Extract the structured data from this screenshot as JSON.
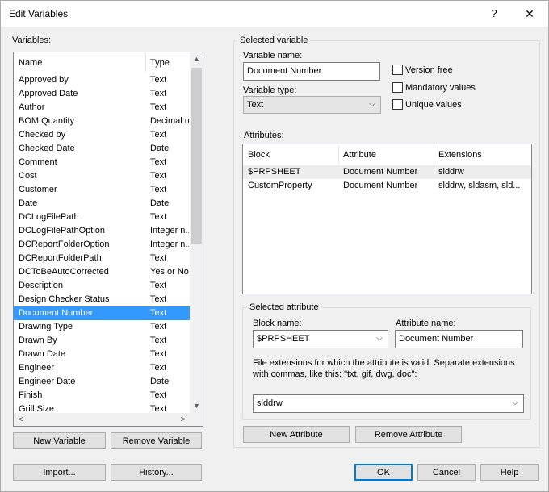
{
  "window": {
    "title": "Edit Variables",
    "help": "?",
    "close": "✕"
  },
  "variables": {
    "label": "Variables:",
    "col_name": "Name",
    "col_type": "Type",
    "items": [
      {
        "name": "Approved by",
        "type": "Text"
      },
      {
        "name": "Approved Date",
        "type": "Text"
      },
      {
        "name": "Author",
        "type": "Text"
      },
      {
        "name": "BOM Quantity",
        "type": "Decimal n..."
      },
      {
        "name": "Checked by",
        "type": "Text"
      },
      {
        "name": "Checked Date",
        "type": "Date"
      },
      {
        "name": "Comment",
        "type": "Text"
      },
      {
        "name": "Cost",
        "type": "Text"
      },
      {
        "name": "Customer",
        "type": "Text"
      },
      {
        "name": "Date",
        "type": "Date"
      },
      {
        "name": "DCLogFilePath",
        "type": "Text"
      },
      {
        "name": "DCLogFilePathOption",
        "type": "Integer n..."
      },
      {
        "name": "DCReportFolderOption",
        "type": "Integer n..."
      },
      {
        "name": "DCReportFolderPath",
        "type": "Text"
      },
      {
        "name": "DCToBeAutoCorrected",
        "type": "Yes or No"
      },
      {
        "name": "Description",
        "type": "Text"
      },
      {
        "name": "Design Checker Status",
        "type": "Text"
      },
      {
        "name": "Document Number",
        "type": "Text"
      },
      {
        "name": "Drawing Type",
        "type": "Text"
      },
      {
        "name": "Drawn By",
        "type": "Text"
      },
      {
        "name": "Drawn Date",
        "type": "Text"
      },
      {
        "name": "Engineer",
        "type": "Text"
      },
      {
        "name": "Engineer Date",
        "type": "Date"
      },
      {
        "name": "Finish",
        "type": "Text"
      },
      {
        "name": "Grill Size",
        "type": "Text"
      }
    ],
    "selected_index": 17,
    "new_button": "New Variable",
    "remove_button": "Remove Variable",
    "import_button": "Import...",
    "history_button": "History..."
  },
  "selected_variable": {
    "group_title": "Selected variable",
    "name_label": "Variable name:",
    "name_value": "Document Number",
    "type_label": "Variable type:",
    "type_value": "Text",
    "version_free": "Version free",
    "mandatory_values": "Mandatory values",
    "unique_values": "Unique values"
  },
  "attributes": {
    "label": "Attributes:",
    "col_block": "Block",
    "col_attribute": "Attribute",
    "col_extensions": "Extensions",
    "rows": [
      {
        "block": "$PRPSHEET",
        "attribute": "Document Number",
        "extensions": "slddrw"
      },
      {
        "block": "CustomProperty",
        "attribute": "Document Number",
        "extensions": "slddrw, sldasm, sld..."
      }
    ],
    "new_button": "New Attribute",
    "remove_button": "Remove Attribute"
  },
  "selected_attribute": {
    "group_title": "Selected attribute",
    "block_label": "Block name:",
    "block_value": "$PRPSHEET",
    "attr_label": "Attribute name:",
    "attr_value": "Document Number",
    "ext_help_line1": "File extensions for which the attribute is valid. Separate extensions",
    "ext_help_line2": "with commas, like this: \"txt, gif, dwg, doc\":",
    "ext_value": "slddrw"
  },
  "footer": {
    "ok": "OK",
    "cancel": "Cancel",
    "help": "Help"
  }
}
